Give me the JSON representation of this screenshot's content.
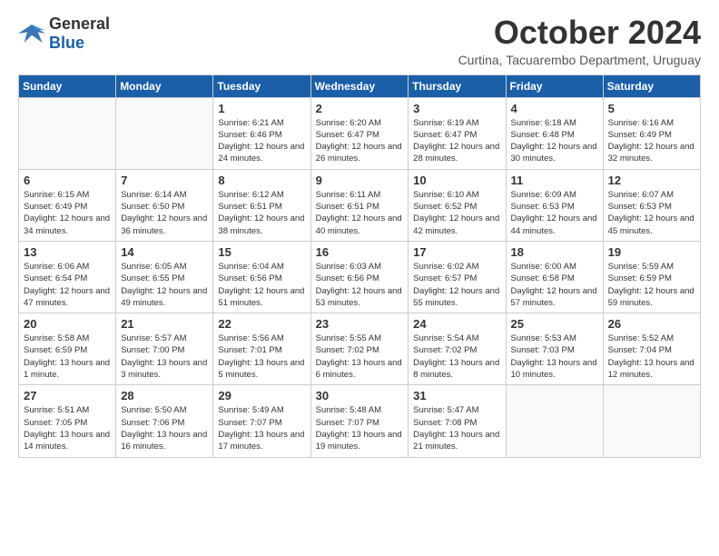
{
  "logo": {
    "general": "General",
    "blue": "Blue"
  },
  "header": {
    "month": "October 2024",
    "location": "Curtina, Tacuarembo Department, Uruguay"
  },
  "days_of_week": [
    "Sunday",
    "Monday",
    "Tuesday",
    "Wednesday",
    "Thursday",
    "Friday",
    "Saturday"
  ],
  "weeks": [
    [
      {
        "day": "",
        "sunrise": "",
        "sunset": "",
        "daylight": ""
      },
      {
        "day": "",
        "sunrise": "",
        "sunset": "",
        "daylight": ""
      },
      {
        "day": "1",
        "sunrise": "Sunrise: 6:21 AM",
        "sunset": "Sunset: 6:46 PM",
        "daylight": "Daylight: 12 hours and 24 minutes."
      },
      {
        "day": "2",
        "sunrise": "Sunrise: 6:20 AM",
        "sunset": "Sunset: 6:47 PM",
        "daylight": "Daylight: 12 hours and 26 minutes."
      },
      {
        "day": "3",
        "sunrise": "Sunrise: 6:19 AM",
        "sunset": "Sunset: 6:47 PM",
        "daylight": "Daylight: 12 hours and 28 minutes."
      },
      {
        "day": "4",
        "sunrise": "Sunrise: 6:18 AM",
        "sunset": "Sunset: 6:48 PM",
        "daylight": "Daylight: 12 hours and 30 minutes."
      },
      {
        "day": "5",
        "sunrise": "Sunrise: 6:16 AM",
        "sunset": "Sunset: 6:49 PM",
        "daylight": "Daylight: 12 hours and 32 minutes."
      }
    ],
    [
      {
        "day": "6",
        "sunrise": "Sunrise: 6:15 AM",
        "sunset": "Sunset: 6:49 PM",
        "daylight": "Daylight: 12 hours and 34 minutes."
      },
      {
        "day": "7",
        "sunrise": "Sunrise: 6:14 AM",
        "sunset": "Sunset: 6:50 PM",
        "daylight": "Daylight: 12 hours and 36 minutes."
      },
      {
        "day": "8",
        "sunrise": "Sunrise: 6:12 AM",
        "sunset": "Sunset: 6:51 PM",
        "daylight": "Daylight: 12 hours and 38 minutes."
      },
      {
        "day": "9",
        "sunrise": "Sunrise: 6:11 AM",
        "sunset": "Sunset: 6:51 PM",
        "daylight": "Daylight: 12 hours and 40 minutes."
      },
      {
        "day": "10",
        "sunrise": "Sunrise: 6:10 AM",
        "sunset": "Sunset: 6:52 PM",
        "daylight": "Daylight: 12 hours and 42 minutes."
      },
      {
        "day": "11",
        "sunrise": "Sunrise: 6:09 AM",
        "sunset": "Sunset: 6:53 PM",
        "daylight": "Daylight: 12 hours and 44 minutes."
      },
      {
        "day": "12",
        "sunrise": "Sunrise: 6:07 AM",
        "sunset": "Sunset: 6:53 PM",
        "daylight": "Daylight: 12 hours and 45 minutes."
      }
    ],
    [
      {
        "day": "13",
        "sunrise": "Sunrise: 6:06 AM",
        "sunset": "Sunset: 6:54 PM",
        "daylight": "Daylight: 12 hours and 47 minutes."
      },
      {
        "day": "14",
        "sunrise": "Sunrise: 6:05 AM",
        "sunset": "Sunset: 6:55 PM",
        "daylight": "Daylight: 12 hours and 49 minutes."
      },
      {
        "day": "15",
        "sunrise": "Sunrise: 6:04 AM",
        "sunset": "Sunset: 6:56 PM",
        "daylight": "Daylight: 12 hours and 51 minutes."
      },
      {
        "day": "16",
        "sunrise": "Sunrise: 6:03 AM",
        "sunset": "Sunset: 6:56 PM",
        "daylight": "Daylight: 12 hours and 53 minutes."
      },
      {
        "day": "17",
        "sunrise": "Sunrise: 6:02 AM",
        "sunset": "Sunset: 6:57 PM",
        "daylight": "Daylight: 12 hours and 55 minutes."
      },
      {
        "day": "18",
        "sunrise": "Sunrise: 6:00 AM",
        "sunset": "Sunset: 6:58 PM",
        "daylight": "Daylight: 12 hours and 57 minutes."
      },
      {
        "day": "19",
        "sunrise": "Sunrise: 5:59 AM",
        "sunset": "Sunset: 6:59 PM",
        "daylight": "Daylight: 12 hours and 59 minutes."
      }
    ],
    [
      {
        "day": "20",
        "sunrise": "Sunrise: 5:58 AM",
        "sunset": "Sunset: 6:59 PM",
        "daylight": "Daylight: 13 hours and 1 minute."
      },
      {
        "day": "21",
        "sunrise": "Sunrise: 5:57 AM",
        "sunset": "Sunset: 7:00 PM",
        "daylight": "Daylight: 13 hours and 3 minutes."
      },
      {
        "day": "22",
        "sunrise": "Sunrise: 5:56 AM",
        "sunset": "Sunset: 7:01 PM",
        "daylight": "Daylight: 13 hours and 5 minutes."
      },
      {
        "day": "23",
        "sunrise": "Sunrise: 5:55 AM",
        "sunset": "Sunset: 7:02 PM",
        "daylight": "Daylight: 13 hours and 6 minutes."
      },
      {
        "day": "24",
        "sunrise": "Sunrise: 5:54 AM",
        "sunset": "Sunset: 7:02 PM",
        "daylight": "Daylight: 13 hours and 8 minutes."
      },
      {
        "day": "25",
        "sunrise": "Sunrise: 5:53 AM",
        "sunset": "Sunset: 7:03 PM",
        "daylight": "Daylight: 13 hours and 10 minutes."
      },
      {
        "day": "26",
        "sunrise": "Sunrise: 5:52 AM",
        "sunset": "Sunset: 7:04 PM",
        "daylight": "Daylight: 13 hours and 12 minutes."
      }
    ],
    [
      {
        "day": "27",
        "sunrise": "Sunrise: 5:51 AM",
        "sunset": "Sunset: 7:05 PM",
        "daylight": "Daylight: 13 hours and 14 minutes."
      },
      {
        "day": "28",
        "sunrise": "Sunrise: 5:50 AM",
        "sunset": "Sunset: 7:06 PM",
        "daylight": "Daylight: 13 hours and 16 minutes."
      },
      {
        "day": "29",
        "sunrise": "Sunrise: 5:49 AM",
        "sunset": "Sunset: 7:07 PM",
        "daylight": "Daylight: 13 hours and 17 minutes."
      },
      {
        "day": "30",
        "sunrise": "Sunrise: 5:48 AM",
        "sunset": "Sunset: 7:07 PM",
        "daylight": "Daylight: 13 hours and 19 minutes."
      },
      {
        "day": "31",
        "sunrise": "Sunrise: 5:47 AM",
        "sunset": "Sunset: 7:08 PM",
        "daylight": "Daylight: 13 hours and 21 minutes."
      },
      {
        "day": "",
        "sunrise": "",
        "sunset": "",
        "daylight": ""
      },
      {
        "day": "",
        "sunrise": "",
        "sunset": "",
        "daylight": ""
      }
    ]
  ]
}
